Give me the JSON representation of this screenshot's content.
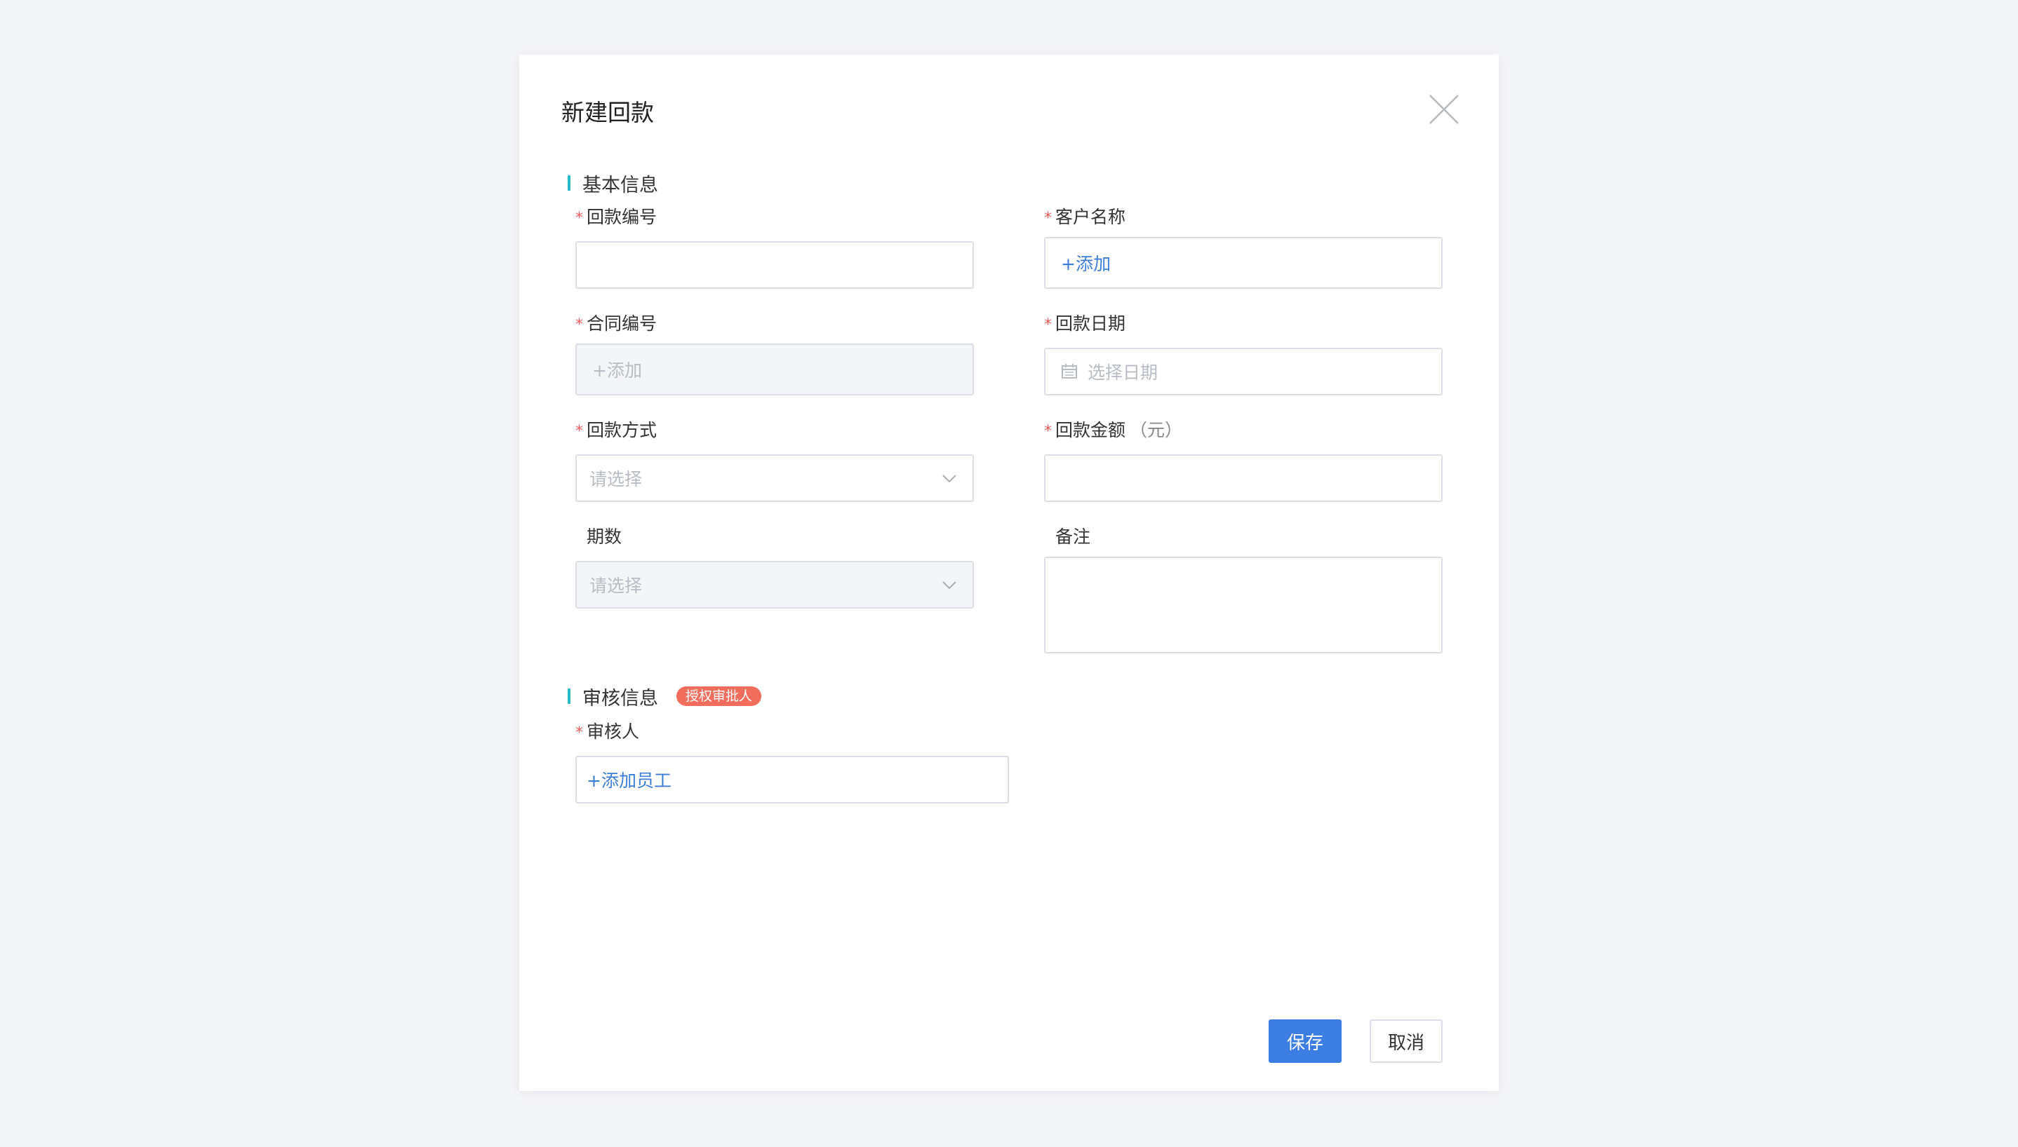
{
  "dialog": {
    "title": "新建回款"
  },
  "sections": {
    "basic": "基本信息",
    "review": "审核信息",
    "review_badge": "授权审批人"
  },
  "fields": {
    "payment_no": {
      "label": "回款编号",
      "required": "*",
      "value": ""
    },
    "customer": {
      "label": "客户名称",
      "required": "*",
      "link": "+添加"
    },
    "contract_no": {
      "label": "合同编号",
      "required": "*",
      "placeholder": "+添加"
    },
    "payment_date": {
      "label": "回款日期",
      "required": "*",
      "placeholder": "选择日期"
    },
    "payment_method": {
      "label": "回款方式",
      "required": "*",
      "placeholder": "请选择"
    },
    "amount": {
      "label": "回款金额",
      "required": "*",
      "unit": "（元）",
      "value": ""
    },
    "period": {
      "label": "期数",
      "placeholder": "请选择"
    },
    "remark": {
      "label": "备注",
      "value": ""
    },
    "reviewer": {
      "label": "审核人",
      "required": "*",
      "link": "+添加员工"
    }
  },
  "buttons": {
    "save": "保存",
    "cancel": "取消"
  },
  "colors": {
    "primary": "#3b7de3",
    "accent_bar": "#26b8c8",
    "required": "#f25b5b",
    "badge": "#f26d5b",
    "link": "#3b7ddb"
  },
  "icons": {
    "close": "close-icon",
    "calendar": "calendar-icon",
    "chevron": "chevron-down-icon"
  }
}
